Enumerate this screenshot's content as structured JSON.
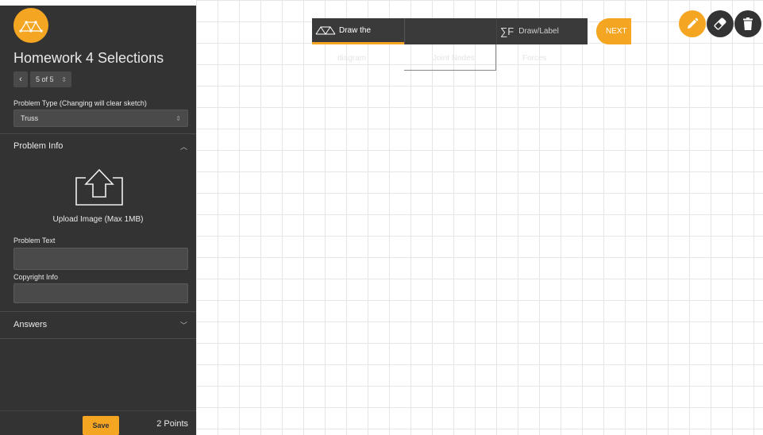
{
  "app": {
    "title": "Homework 4 Selections",
    "logo_icon": "truss-logo-icon"
  },
  "pager": {
    "current": "5 of 5",
    "prev_icon": "chevron-left-icon"
  },
  "problem_type": {
    "label": "Problem Type (Changing will clear sketch)",
    "value": "Truss"
  },
  "problem_info": {
    "heading": "Problem Info",
    "upload_label": "Upload Image (Max 1MB)",
    "problem_text_label": "Problem Text",
    "problem_text_value": "",
    "copyright_label": "Copyright Info",
    "copyright_value": ""
  },
  "answers": {
    "heading": "Answers"
  },
  "footer": {
    "save_label": "Save",
    "points": "2 Points"
  },
  "toolbar": {
    "tabs": [
      {
        "label": "Draw the",
        "icon": "truss-icon",
        "active": true
      },
      {
        "label": "",
        "icon": "",
        "active": false
      },
      {
        "label": "Draw/Label",
        "icon": "sigma-f-icon",
        "active": false
      }
    ],
    "sigma_symbol": "∑F",
    "ghost_labels": [
      "diagram",
      "Joint Nodes",
      "Forces"
    ],
    "next_label": "NEXT"
  },
  "tools": [
    "pencil-icon",
    "eraser-icon",
    "trash-icon"
  ],
  "colors": {
    "accent": "#f4a623",
    "sidebar": "#333333",
    "grid": "#e6e6e6"
  }
}
